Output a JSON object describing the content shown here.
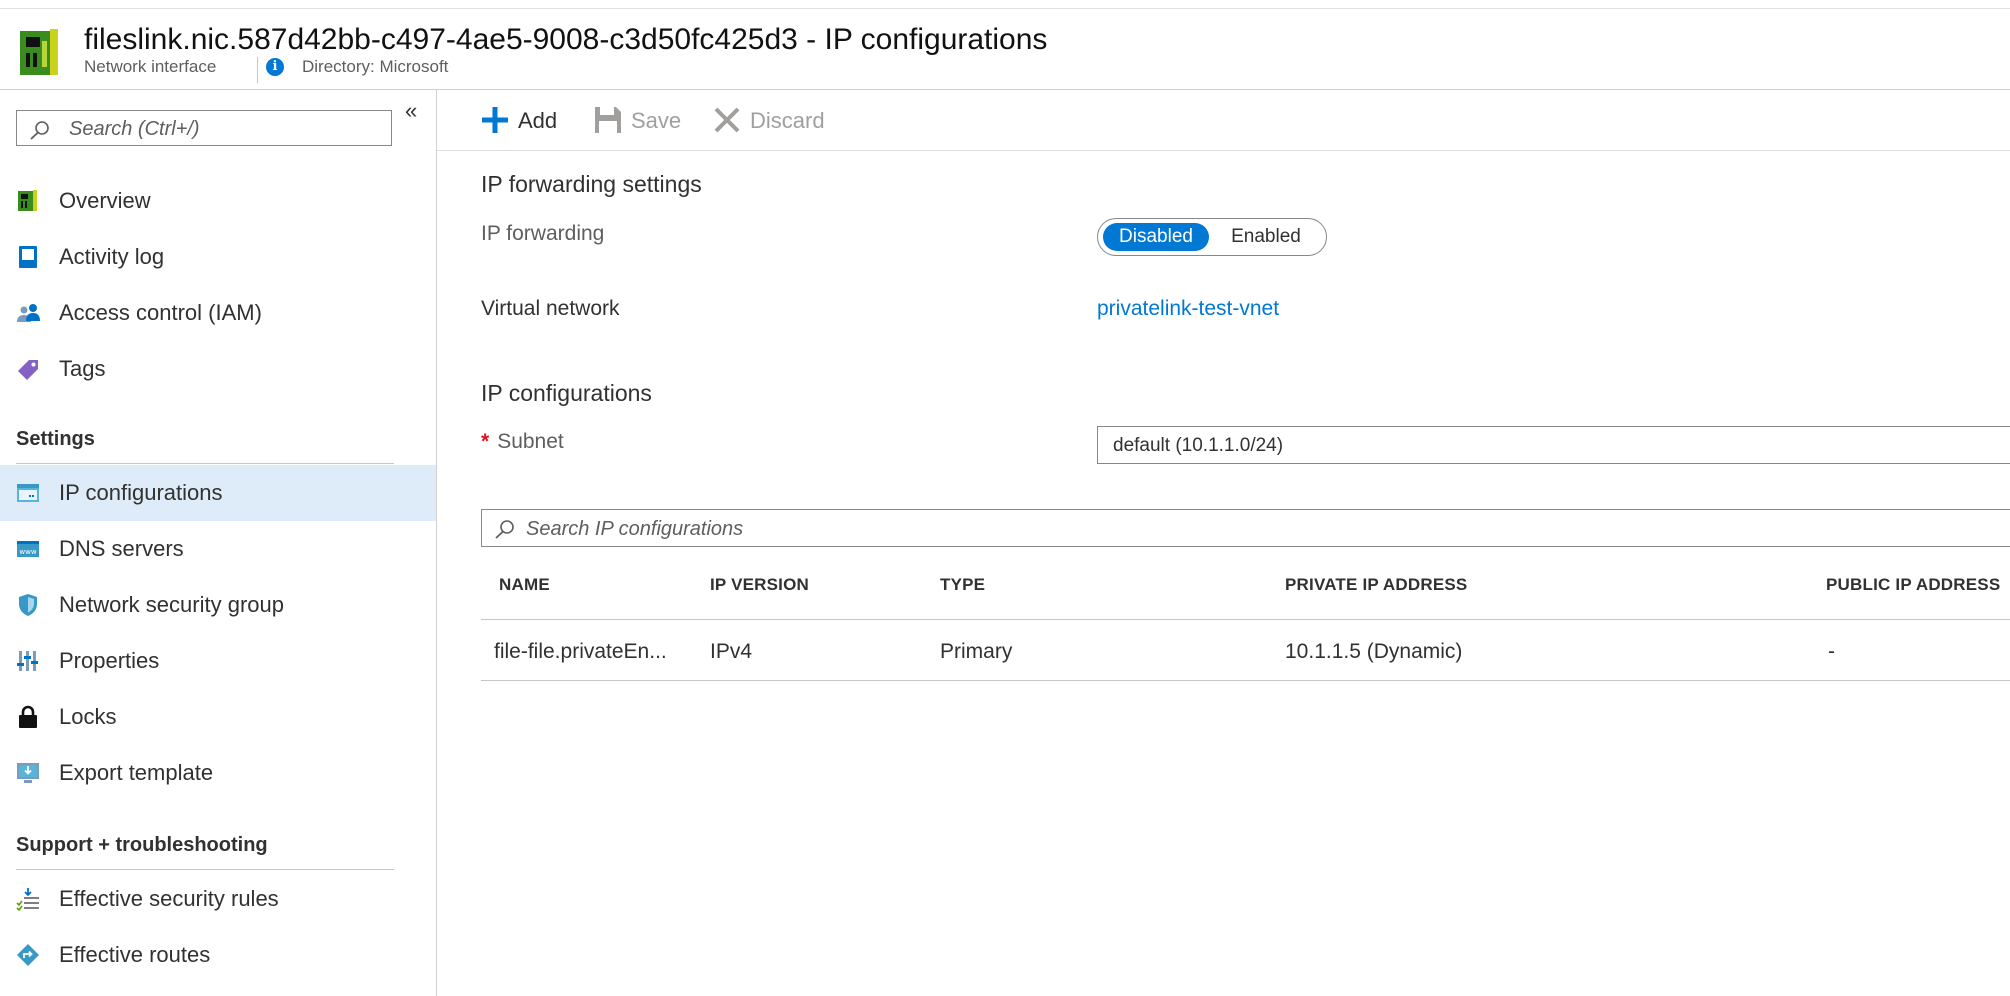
{
  "header": {
    "title": "fileslink.nic.587d42bb-c497-4ae5-9008-c3d50fc425d3 - IP configurations",
    "resource_type": "Network interface",
    "directory": "Directory: Microsoft"
  },
  "sidebar": {
    "collapse_glyph": "«",
    "search_placeholder": "Search (Ctrl+/)",
    "items": [
      {
        "label": "Overview",
        "icon": "network-interface-icon"
      },
      {
        "label": "Activity log",
        "icon": "activity-log-icon"
      },
      {
        "label": "Access control (IAM)",
        "icon": "iam-icon"
      },
      {
        "label": "Tags",
        "icon": "tag-icon"
      }
    ],
    "settings_header": "Settings",
    "settings_items": [
      {
        "label": "IP configurations",
        "icon": "ip-config-icon",
        "active": true
      },
      {
        "label": "DNS servers",
        "icon": "dns-icon"
      },
      {
        "label": "Network security group",
        "icon": "shield-icon"
      },
      {
        "label": "Properties",
        "icon": "properties-icon"
      },
      {
        "label": "Locks",
        "icon": "lock-icon"
      },
      {
        "label": "Export template",
        "icon": "export-template-icon"
      }
    ],
    "support_header": "Support + troubleshooting",
    "support_items": [
      {
        "label": "Effective security rules",
        "icon": "security-rules-icon"
      },
      {
        "label": "Effective routes",
        "icon": "routes-icon"
      }
    ]
  },
  "toolbar": {
    "add_label": "Add",
    "save_label": "Save",
    "discard_label": "Discard"
  },
  "main": {
    "forwarding_title": "IP forwarding settings",
    "forwarding_label": "IP forwarding",
    "forwarding_options": [
      "Disabled",
      "Enabled"
    ],
    "forwarding_selected": "Disabled",
    "vnet_label": "Virtual network",
    "vnet_value": "privatelink-test-vnet",
    "ipconfig_title": "IP configurations",
    "subnet_label": "Subnet",
    "subnet_required": "*",
    "subnet_value": "default (10.1.1.0/24)",
    "search_placeholder": "Search IP configurations"
  },
  "table": {
    "columns": [
      "NAME",
      "IP VERSION",
      "TYPE",
      "PRIVATE IP ADDRESS",
      "PUBLIC IP ADDRESS"
    ],
    "rows": [
      [
        "file-file.privateEn...",
        "IPv4",
        "Primary",
        "10.1.1.5 (Dynamic)",
        "-"
      ]
    ]
  },
  "colors": {
    "accent": "#0078d4",
    "active_nav_bg": "#deecf9",
    "required": "#e81123"
  }
}
